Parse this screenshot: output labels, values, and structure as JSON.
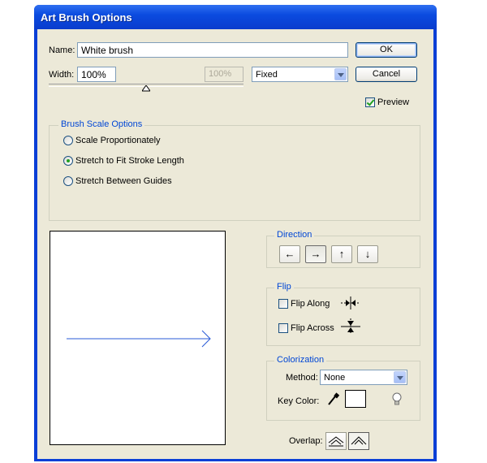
{
  "window": {
    "title": "Art Brush Options"
  },
  "name": {
    "label": "Name:",
    "value": "White brush"
  },
  "width": {
    "label": "Width:",
    "value": "100%",
    "secondary_value": "100%",
    "mode": "Fixed"
  },
  "buttons": {
    "ok": "OK",
    "cancel": "Cancel"
  },
  "preview": {
    "label": "Preview",
    "checked": true
  },
  "brush_scale": {
    "title": "Brush Scale Options",
    "options": [
      {
        "label": "Scale Proportionately",
        "checked": false
      },
      {
        "label": "Stretch to Fit Stroke Length",
        "checked": true
      },
      {
        "label": "Stretch Between Guides",
        "checked": false
      }
    ]
  },
  "direction": {
    "title": "Direction",
    "arrows": [
      "←",
      "→",
      "↑",
      "↓"
    ],
    "selected_index": 1
  },
  "flip": {
    "title": "Flip",
    "along": {
      "label": "Flip Along",
      "checked": false
    },
    "across": {
      "label": "Flip Across",
      "checked": false
    }
  },
  "colorization": {
    "title": "Colorization",
    "method_label": "Method:",
    "method_value": "None",
    "key_color_label": "Key Color:",
    "key_color": "#ffffff"
  },
  "overlap": {
    "label": "Overlap:",
    "selected_index": 1
  },
  "colors": {
    "title_bar": "#0a3fd6",
    "dialog_bg": "#ece9d8",
    "group_title": "#0046d5",
    "preview_stroke": "#2a5bd7"
  }
}
